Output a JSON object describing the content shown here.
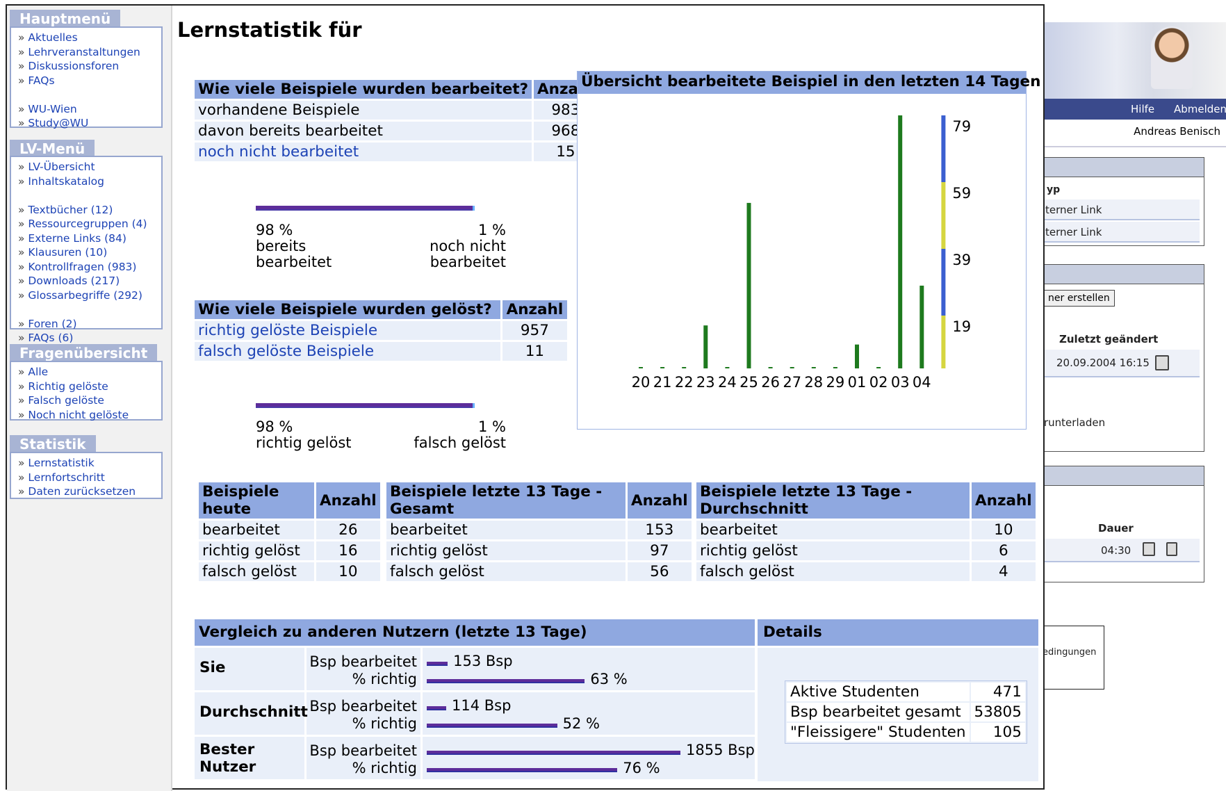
{
  "background_window": {
    "nav": {
      "help": "Hilfe",
      "logout": "Abmelden"
    },
    "user": "Andreas Benisch",
    "section1": {
      "col": "yp",
      "rows": [
        "terner Link",
        "terner Link"
      ]
    },
    "section2": {
      "button": "ner erstellen",
      "col_changed": "Zuletzt geändert",
      "row_date": "20.09.2004 16:15",
      "download": "runterladen"
    },
    "section3": {
      "col_duration": "Dauer",
      "row_duration": "04:30"
    },
    "footer": "edingungen"
  },
  "sidebar": {
    "hauptmenu": {
      "title": "Hauptmenü",
      "items": [
        "Aktuelles",
        "Lehrveranstaltungen",
        "Diskussionsforen",
        "FAQs",
        "",
        "WU-Wien",
        "Study@WU"
      ]
    },
    "lvmenu": {
      "title": "LV-Menü",
      "items": [
        "LV-Übersicht",
        "Inhaltskatalog",
        "",
        "Textbücher (12)",
        "Ressourcegruppen (4)",
        "Externe Links (84)",
        "Klausuren (10)",
        "Kontrollfragen (983)",
        "Downloads (217)",
        "Glossarbegriffe (292)",
        "",
        "Foren (2)",
        "FAQs (6)"
      ]
    },
    "fragen": {
      "title": "Fragenübersicht",
      "items": [
        "Alle",
        "Richtig gelöste",
        "Falsch gelöste",
        "Noch nicht gelöste"
      ]
    },
    "statistik": {
      "title": "Statistik",
      "items": [
        "Lernstatistik",
        "Lernfortschritt",
        "Daten zurücksetzen"
      ]
    }
  },
  "page": {
    "title": "Lernstatistik für"
  },
  "worked": {
    "header": "Wie viele Beispiele wurden bearbeitet?",
    "count_header": "Anzahl",
    "rows": [
      {
        "label": "vorhandene Beispiele",
        "value": "983"
      },
      {
        "label": "davon bereits bearbeitet",
        "value": "968"
      },
      {
        "label": "noch nicht bearbeitet",
        "value": "15"
      }
    ],
    "ratio": 0.98,
    "left_pct": "98 %",
    "left_l1": "bereits",
    "left_l2": "bearbeitet",
    "right_pct": "1 %",
    "right_l1": "noch nicht",
    "right_l2": "bearbeitet"
  },
  "solved": {
    "header": "Wie viele Beispiele wurden gelöst?",
    "count_header": "Anzahl",
    "rows": [
      {
        "label": "richtig gelöste Beispiele",
        "value": "957"
      },
      {
        "label": "falsch gelöste Beispiele",
        "value": "11"
      }
    ],
    "ratio": 0.98,
    "left_pct": "98 %",
    "left_label": "richtig gelöst",
    "right_pct": "1 %",
    "right_label": "falsch gelöst"
  },
  "chart_data": {
    "type": "bar",
    "title": "Übersicht bearbeitete Beispiel in den letzten 14 Tagen",
    "categories": [
      "20",
      "21",
      "22",
      "23",
      "24",
      "25",
      "26",
      "27",
      "28",
      "29",
      "01",
      "02",
      "03",
      "04"
    ],
    "values": [
      0,
      0,
      0,
      27,
      0,
      104,
      0,
      0,
      0,
      0,
      15,
      0,
      159,
      52
    ],
    "scale_labels": [
      "79",
      "59",
      "39",
      "19"
    ],
    "bar_color": "#1e7a1e",
    "scale_colors": [
      "#3b5fd0",
      "#d6d640"
    ]
  },
  "today": {
    "h1": "Beispiele",
    "h2": "heute",
    "count_header": "Anzahl",
    "rows": [
      {
        "label": "bearbeitet",
        "value": "26"
      },
      {
        "label": "richtig gelöst",
        "value": "16"
      },
      {
        "label": "falsch gelöst",
        "value": "10"
      }
    ]
  },
  "total13": {
    "h1": "Beispiele letzte 13 Tage -",
    "h2": "Gesamt",
    "count_header": "Anzahl",
    "rows": [
      {
        "label": "bearbeitet",
        "value": "153"
      },
      {
        "label": "richtig gelöst",
        "value": "97"
      },
      {
        "label": "falsch gelöst",
        "value": "56"
      }
    ]
  },
  "avg13": {
    "h1": "Beispiele letzte 13 Tage -",
    "h2": "Durchschnitt",
    "count_header": "Anzahl",
    "rows": [
      {
        "label": "bearbeitet",
        "value": "10"
      },
      {
        "label": "richtig gelöst",
        "value": "6"
      },
      {
        "label": "falsch gelöst",
        "value": "4"
      }
    ]
  },
  "compare": {
    "header": "Vergleich zu anderen Nutzern (letzte 13 Tage)",
    "label_worked": "Bsp bearbeitet",
    "label_correct": "% richtig",
    "rows": [
      {
        "name1": "Sie",
        "name2": "",
        "worked": 153,
        "worked_text": "153 Bsp",
        "correct": 63,
        "correct_text": "63 %"
      },
      {
        "name1": "Durchschnitt",
        "name2": "",
        "worked": 114,
        "worked_text": "114 Bsp",
        "correct": 52,
        "correct_text": "52 %"
      },
      {
        "name1": "Bester",
        "name2": "Nutzer",
        "worked": 1855,
        "worked_text": "1855 Bsp",
        "correct": 76,
        "correct_text": "76 %"
      }
    ]
  },
  "details": {
    "header": "Details",
    "rows": [
      {
        "label": "Aktive Studenten",
        "value": "471"
      },
      {
        "label": "Bsp bearbeitet gesamt",
        "value": "53805"
      },
      {
        "label": "\"Fleissigere\" Studenten",
        "value": "105"
      }
    ]
  }
}
